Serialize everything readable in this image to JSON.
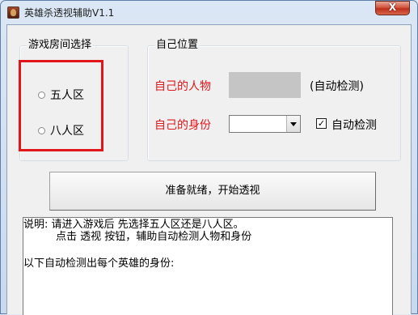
{
  "window": {
    "title": "英雄杀透视辅助V1.1",
    "close_symbol": "X"
  },
  "room_group": {
    "label": "游戏房间选择",
    "options": [
      {
        "label": "五人区",
        "selected": false
      },
      {
        "label": "八人区",
        "selected": false
      }
    ]
  },
  "self_group": {
    "label": "自己位置",
    "character_label": "自己的人物",
    "character_value": "",
    "auto_detect_note": "(自动检测)",
    "identity_label": "自己的身份",
    "identity_value": "",
    "auto_detect_checkbox": {
      "label": "自动检测",
      "checked": true,
      "mark": "✓"
    }
  },
  "start_button": {
    "label": "准备就绪，开始透视"
  },
  "info": {
    "line1": "说明: 请进入游戏后 先选择五人区还是八人区。",
    "line2": "点击 透视 按钮，辅助自动检测人物和身份",
    "line3": "以下自动检测出每个英雄的身份:"
  },
  "colors": {
    "highlight": "#e1161b",
    "label_red": "#e1161b"
  }
}
